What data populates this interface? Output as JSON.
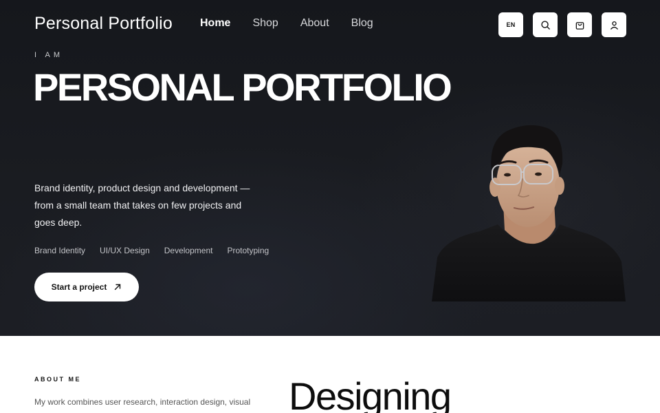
{
  "header": {
    "logo": "Personal Portfolio",
    "nav": [
      {
        "label": "Home",
        "active": true
      },
      {
        "label": "Shop",
        "active": false
      },
      {
        "label": "About",
        "active": false
      },
      {
        "label": "Blog",
        "active": false
      }
    ],
    "language": "EN",
    "icons": [
      "search-icon",
      "cart-icon",
      "user-icon"
    ]
  },
  "hero": {
    "eyebrow": "I AM",
    "title": "PERSONAL PORTFOLIO",
    "intro": "Brand identity, product design and development — from a small team that takes on few projects and goes deep.",
    "services": [
      "Brand Identity",
      "UI/UX Design",
      "Development",
      "Prototyping"
    ],
    "cta": "Start a project",
    "background_color": "#17191e"
  },
  "about": {
    "label": "ABOUT ME",
    "text": "My work combines user research, interaction design, visual",
    "heading": "Designing"
  }
}
